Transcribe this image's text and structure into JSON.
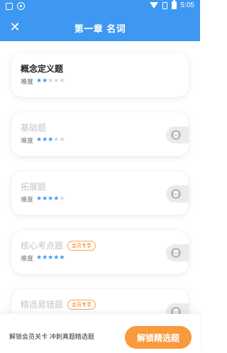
{
  "status_bar": {
    "time": "5:05"
  },
  "header": {
    "close_symbol": "✕",
    "title": "第一章 名词"
  },
  "difficulty_label": "难度",
  "cards": [
    {
      "name": "概念定义题",
      "stars": 2,
      "locked": false,
      "badge": ""
    },
    {
      "name": "基础题",
      "stars": 3,
      "locked": true,
      "badge": ""
    },
    {
      "name": "拓展题",
      "stars": 4,
      "locked": true,
      "badge": ""
    },
    {
      "name": "核心考点题",
      "stars": 5,
      "locked": true,
      "badge": "会员专享"
    },
    {
      "name": "精选易错题",
      "stars": 5,
      "locked": true,
      "badge": "会员专享"
    }
  ],
  "bottom": {
    "text": "解锁会员关卡 冲刺真题精选题",
    "button": "解锁精选题"
  },
  "colors": {
    "primary": "#3e98f1",
    "accent": "#f99a3c",
    "star_on": "#3e98f1",
    "star_off": "#d3d3d3"
  }
}
